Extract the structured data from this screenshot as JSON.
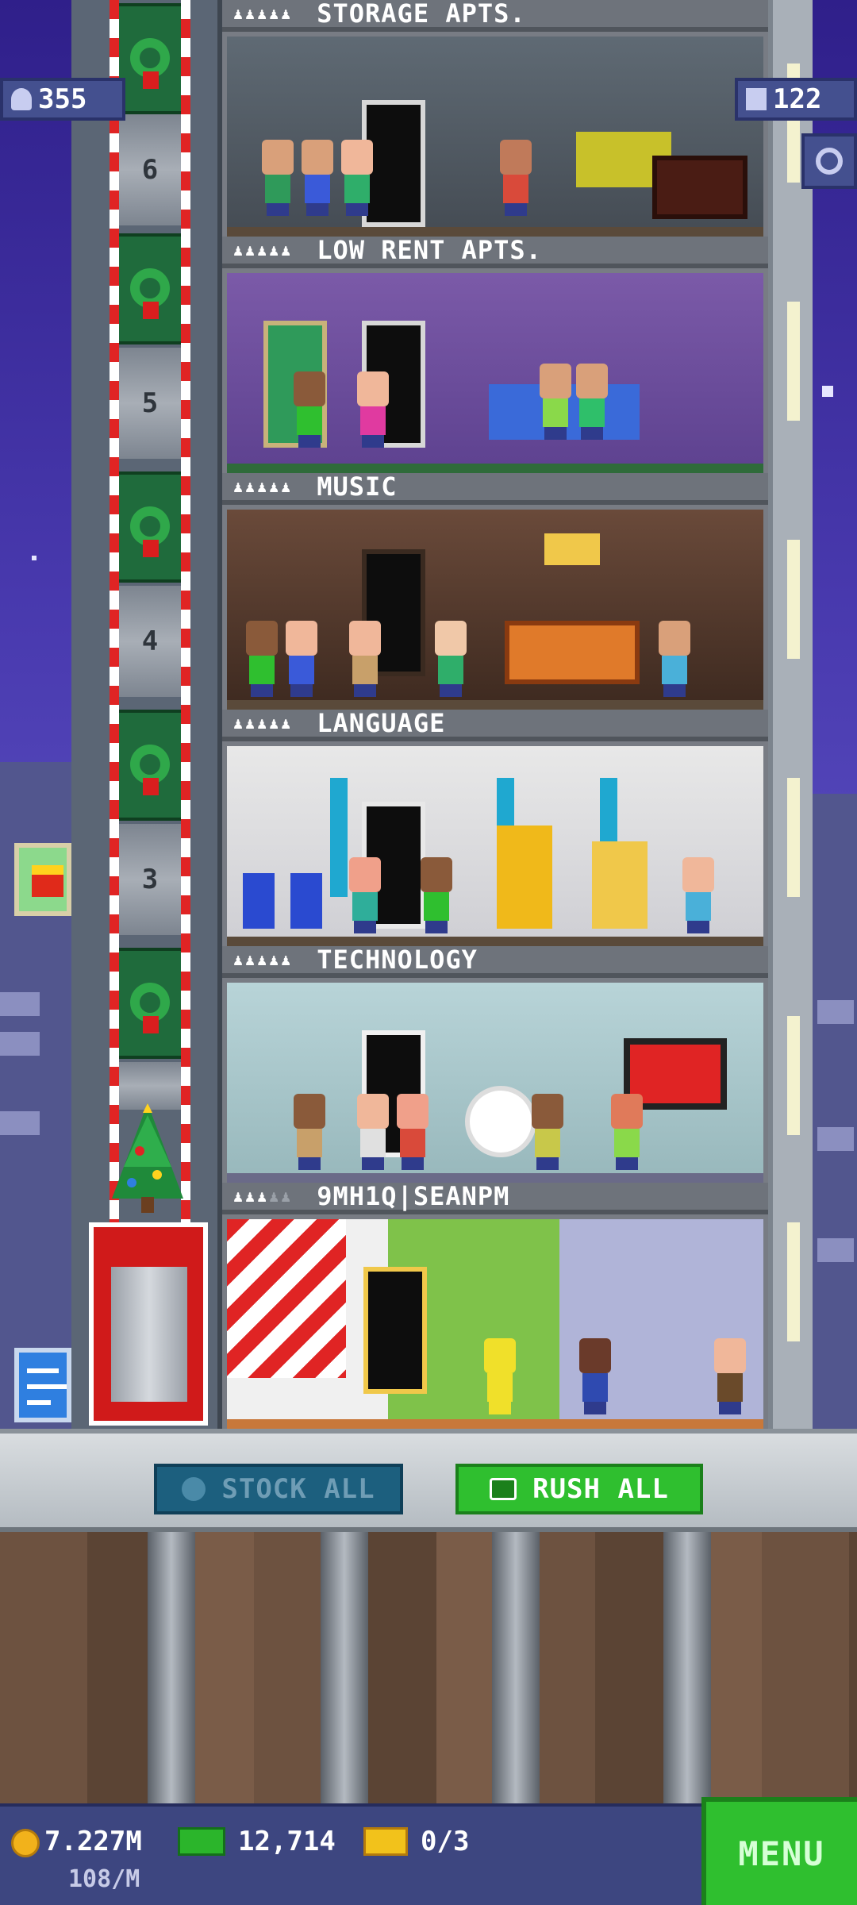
{
  "top_hud": {
    "population": "355",
    "population_icon": "person-icon",
    "floors": "122",
    "floors_icon": "building-icon",
    "search_icon": "magnifier-icon"
  },
  "elevator": {
    "floor_numbers": [
      "6",
      "5",
      "4",
      "3"
    ]
  },
  "floors": [
    {
      "name": "STORAGE APTS.",
      "stars_filled": 5,
      "type": "residential"
    },
    {
      "name": "LOW RENT APTS.",
      "stars_filled": 5,
      "type": "residential"
    },
    {
      "name": "MUSIC",
      "stars_filled": 5,
      "type": "creative"
    },
    {
      "name": "LANGUAGE",
      "stars_filled": 5,
      "type": "service"
    },
    {
      "name": "TECHNOLOGY",
      "stars_filled": 5,
      "type": "service"
    },
    {
      "name": "9MH1Q|SEANPM",
      "stars_filled": 3,
      "type": "custom"
    }
  ],
  "actions": {
    "stock_all": "STOCK ALL",
    "rush_all": "RUSH ALL"
  },
  "bottom_hud": {
    "coins": "7.227M",
    "coins_rate": "108/M",
    "bux": "12,714",
    "tickets": "0/3",
    "menu": "MENU"
  },
  "colors": {
    "sky": "#4a3bb0",
    "rush_green": "#2fbf2f",
    "stock_blue": "#1c5f7e",
    "elevator_red": "#d01a1a"
  }
}
